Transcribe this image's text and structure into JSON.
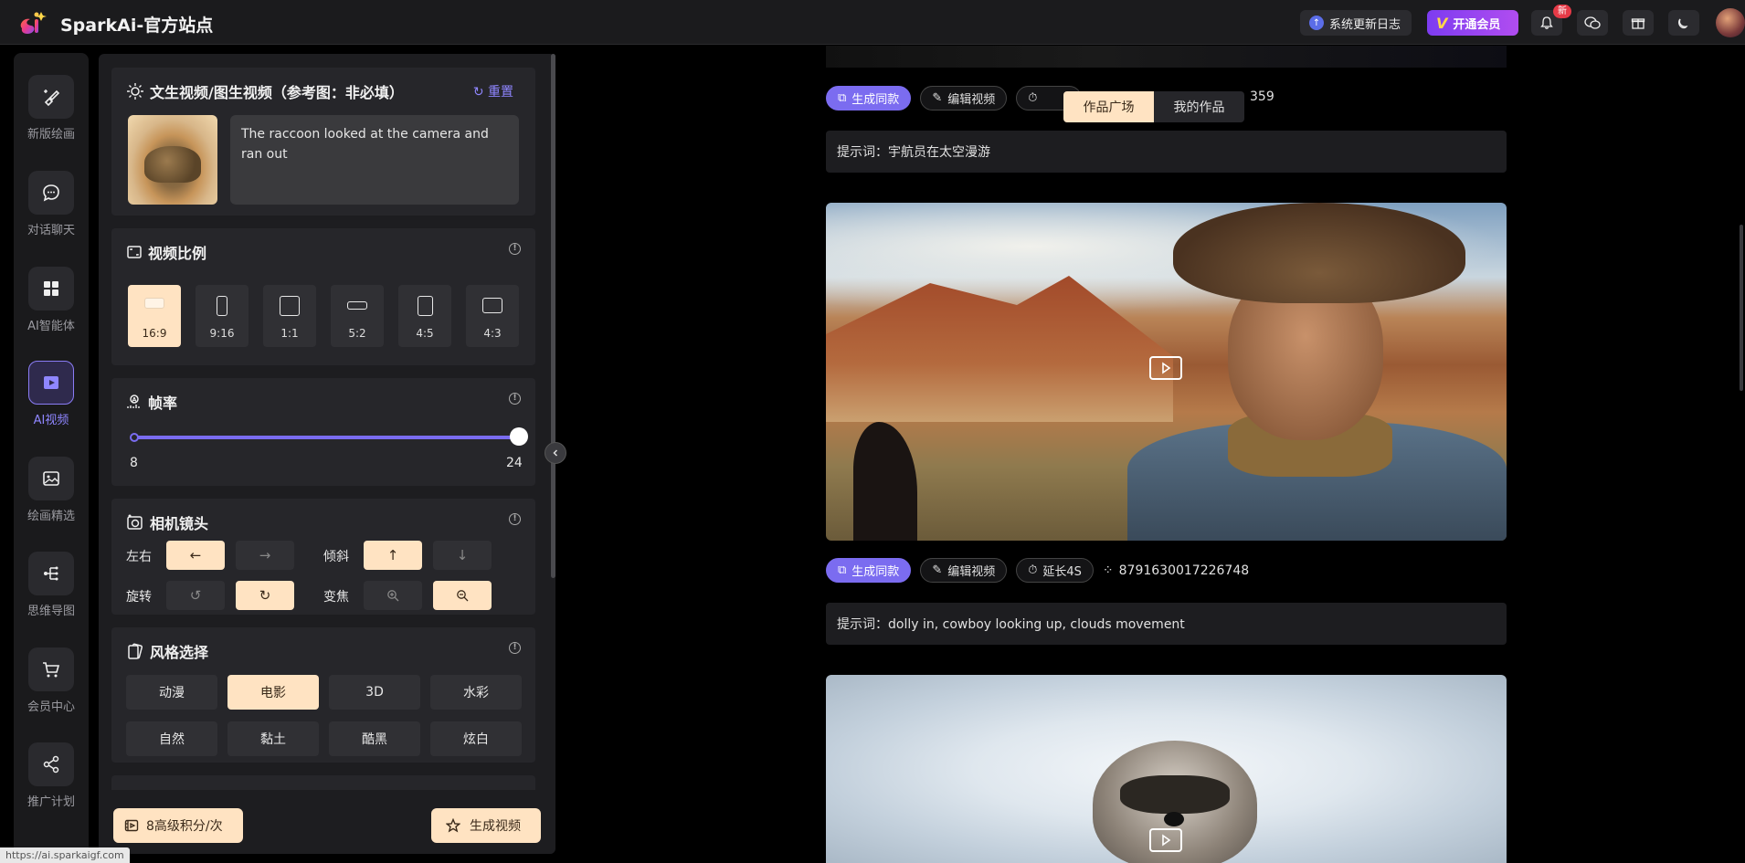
{
  "header": {
    "site_title": "SparkAi-官方站点",
    "update_log": "系统更新日志",
    "vip": "开通会员",
    "new_badge": "新",
    "colors": {
      "accent": "#7b6cf0",
      "vip": "#9b45f0",
      "highlight": "#ffe3c2"
    }
  },
  "rail": {
    "items": [
      {
        "label": "新版绘画",
        "icon": "brush-icon"
      },
      {
        "label": "对话聊天",
        "icon": "chat-icon"
      },
      {
        "label": "AI智能体",
        "icon": "grid-icon"
      },
      {
        "label": "AI视频",
        "icon": "video-icon",
        "active": true
      },
      {
        "label": "绘画精选",
        "icon": "image-icon"
      },
      {
        "label": "思维导图",
        "icon": "mindmap-icon"
      },
      {
        "label": "会员中心",
        "icon": "cart-icon"
      },
      {
        "label": "推广计划",
        "icon": "share-icon"
      }
    ]
  },
  "panel": {
    "prompt_card": {
      "title": "文生视频/图生视频（参考图：非必填）",
      "reset": "重置",
      "prompt_text": "The raccoon looked at the camera and ran out"
    },
    "ratio_card": {
      "title": "视频比例",
      "options": [
        "16:9",
        "9:16",
        "1:1",
        "5:2",
        "4:5",
        "4:3"
      ],
      "selected": "16:9"
    },
    "fps_card": {
      "title": "帧率",
      "min": "8",
      "max": "24",
      "value_fraction": 1.0
    },
    "camera_card": {
      "title": "相机镜头",
      "rows": [
        {
          "label": "左右",
          "pair_label": "倾斜"
        },
        {
          "label": "旋转",
          "pair_label": "变焦"
        }
      ]
    },
    "style_card": {
      "title": "风格选择",
      "options": [
        "动漫",
        "电影",
        "3D",
        "水彩",
        "自然",
        "黏土",
        "酷黑",
        "炫白"
      ],
      "selected": "电影"
    },
    "bottom": {
      "credits": "8高级积分/次",
      "generate": "生成视频"
    }
  },
  "feed": {
    "tabs": [
      "作品广场",
      "我的作品"
    ],
    "active_tab": "作品广场",
    "items": [
      {
        "actions": [
          "生成同款",
          "编辑视频",
          "延长4S"
        ],
        "seed_visible": "359",
        "prompt": "提示词：宇航员在太空漫游"
      },
      {
        "actions": [
          "生成同款",
          "编辑视频",
          "延长4S"
        ],
        "seed": "8791630017226748",
        "prompt": "提示词：dolly in, cowboy looking up, clouds movement"
      }
    ]
  },
  "status_url": "https://ai.sparkaigf.com"
}
